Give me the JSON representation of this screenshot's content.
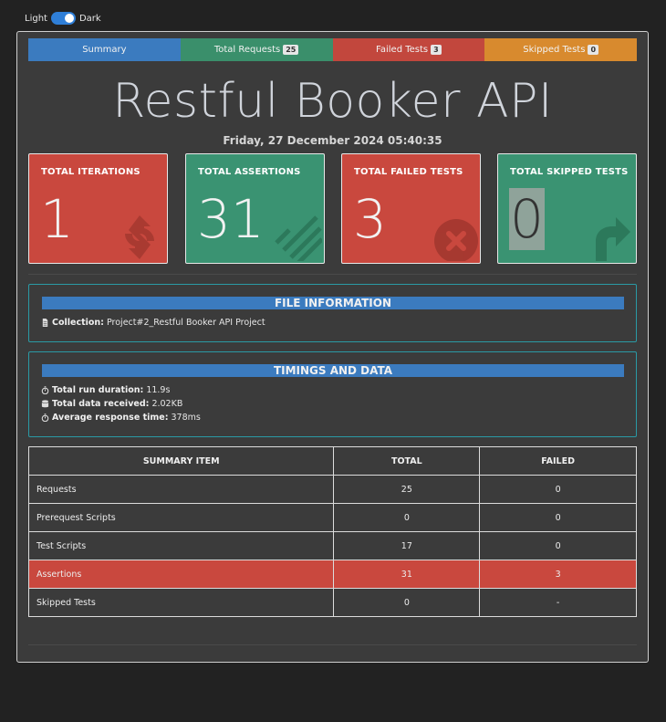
{
  "theme": {
    "light_label": "Light",
    "dark_label": "Dark"
  },
  "tabs": [
    {
      "label": "Summary"
    },
    {
      "label": "Total Requests",
      "badge": "25"
    },
    {
      "label": "Failed Tests",
      "badge": "3"
    },
    {
      "label": "Skipped Tests",
      "badge": "0"
    }
  ],
  "title": "Restful Booker API",
  "date": "Friday, 27 December 2024 05:40:35",
  "cards": [
    {
      "label": "TOTAL ITERATIONS",
      "value": "1",
      "icon": "refresh-icon"
    },
    {
      "label": "TOTAL ASSERTIONS",
      "value": "31",
      "icon": "list-icon"
    },
    {
      "label": "TOTAL FAILED TESTS",
      "value": "3",
      "icon": "times-circle-icon"
    },
    {
      "label": "TOTAL SKIPPED TESTS",
      "value": "0",
      "icon": "share-arrow-icon"
    }
  ],
  "file_info": {
    "heading": "FILE INFORMATION",
    "collection_label": "Collection:",
    "collection_value": "Project#2_Restful Booker API Project"
  },
  "timings": {
    "heading": "TIMINGS AND DATA",
    "duration_label": "Total run duration:",
    "duration_value": "11.9s",
    "data_label": "Total data received:",
    "data_value": "2.02KB",
    "avg_label": "Average response time:",
    "avg_value": "378ms"
  },
  "summary_table": {
    "headers": [
      "SUMMARY ITEM",
      "TOTAL",
      "FAILED"
    ],
    "rows": [
      [
        "Requests",
        "25",
        "0"
      ],
      [
        "Prerequest Scripts",
        "0",
        "0"
      ],
      [
        "Test Scripts",
        "17",
        "0"
      ],
      [
        "Assertions",
        "31",
        "3"
      ],
      [
        "Skipped Tests",
        "0",
        "-"
      ]
    ]
  },
  "colors": {
    "summary": "#3b7bbf",
    "success": "#3a9372",
    "danger": "#c9483e",
    "warning": "#d88a2e"
  }
}
